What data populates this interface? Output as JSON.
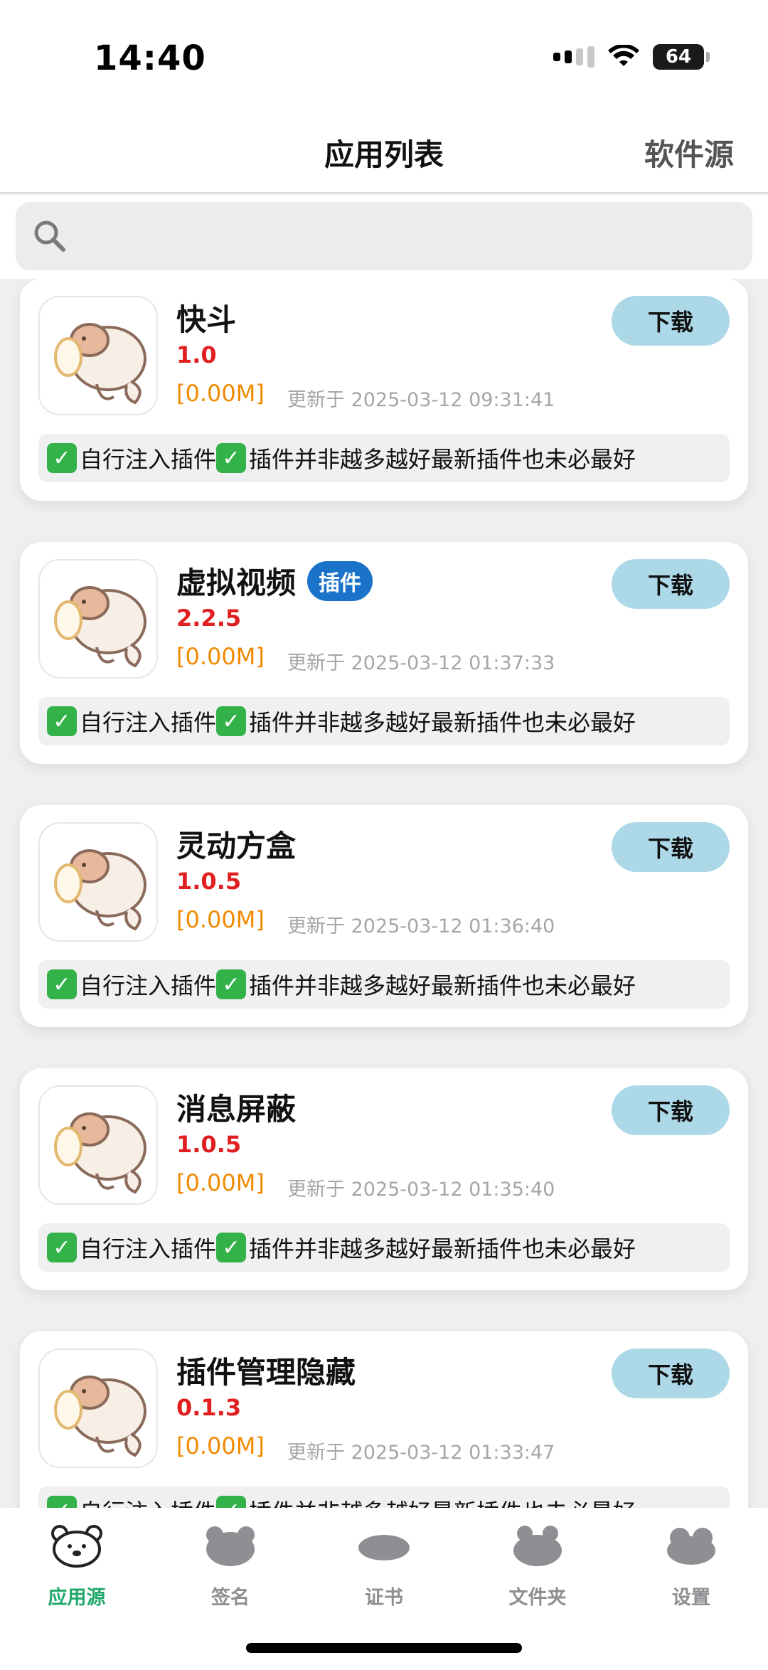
{
  "status_bar": {
    "time": "14:40",
    "battery": "64"
  },
  "nav": {
    "title": "应用列表",
    "right_action": "软件源"
  },
  "search": {
    "placeholder": ""
  },
  "apps": [
    {
      "name": "快斗",
      "badge": "",
      "version": "1.0",
      "size": "[0.00M]",
      "updated": "更新于 2025-03-12 09:31:41",
      "download_label": "下载",
      "check_a": "✓",
      "desc_a": "自行注入插件",
      "check_b": "✓",
      "desc_b": "插件并非越多越好最新插件也未必最好"
    },
    {
      "name": "虚拟视频",
      "badge": "插件",
      "version": "2.2.5",
      "size": "[0.00M]",
      "updated": "更新于 2025-03-12 01:37:33",
      "download_label": "下载",
      "check_a": "✓",
      "desc_a": "自行注入插件",
      "check_b": "✓",
      "desc_b": "插件并非越多越好最新插件也未必最好"
    },
    {
      "name": "灵动方盒",
      "badge": "",
      "version": "1.0.5",
      "size": "[0.00M]",
      "updated": "更新于 2025-03-12 01:36:40",
      "download_label": "下载",
      "check_a": "✓",
      "desc_a": "自行注入插件",
      "check_b": "✓",
      "desc_b": "插件并非越多越好最新插件也未必最好"
    },
    {
      "name": "消息屏蔽",
      "badge": "",
      "version": "1.0.5",
      "size": "[0.00M]",
      "updated": "更新于 2025-03-12 01:35:40",
      "download_label": "下载",
      "check_a": "✓",
      "desc_a": "自行注入插件",
      "check_b": "✓",
      "desc_b": "插件并非越多越好最新插件也未必最好"
    },
    {
      "name": "插件管理隐藏",
      "badge": "",
      "version": "0.1.3",
      "size": "[0.00M]",
      "updated": "更新于 2025-03-12 01:33:47",
      "download_label": "下载",
      "check_a": "✓",
      "desc_a": "自行注入插件",
      "check_b": "✓",
      "desc_b": "插件并非越多越好最新插件也未必最好"
    }
  ],
  "tabs": [
    {
      "label": "应用源",
      "icon": "bear-icon",
      "active": true
    },
    {
      "label": "签名",
      "icon": "signature-icon",
      "active": false
    },
    {
      "label": "证书",
      "icon": "certificate-icon",
      "active": false
    },
    {
      "label": "文件夹",
      "icon": "folder-icon",
      "active": false
    },
    {
      "label": "设置",
      "icon": "settings-icon",
      "active": false
    }
  ],
  "colors": {
    "accent": "#1fa86a",
    "version": "#e02020",
    "size": "#f08a00",
    "download_button": "#acd8e8",
    "badge": "#1a73c9"
  }
}
